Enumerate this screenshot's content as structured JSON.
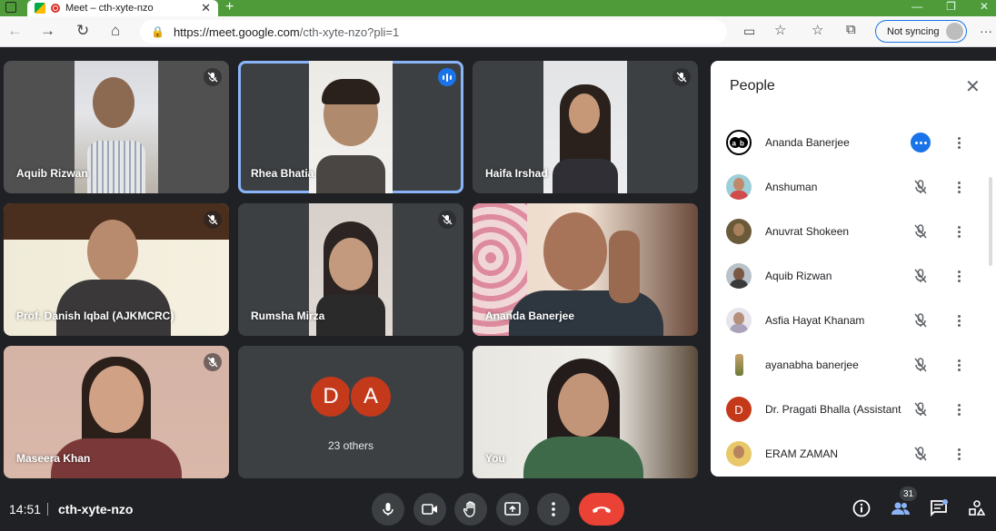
{
  "browser": {
    "tab_title": "Meet – cth-xyte-nzo",
    "url_host": "https://meet.google.com",
    "url_path": "/cth-xyte-nzo?pli=1",
    "sync_label": "Not syncing"
  },
  "tiles": [
    {
      "name": "Aquib Rizwan",
      "muted": true
    },
    {
      "name": "Rhea Bhatia",
      "speaking": true
    },
    {
      "name": "Haifa Irshad",
      "muted": true
    },
    {
      "name": "Prof. Danish Iqbal (AJKMCRC)",
      "muted": true
    },
    {
      "name": "Rumsha Mirza",
      "muted": true
    },
    {
      "name": "Ananda Banerjee"
    },
    {
      "name": "Maseera Khan",
      "muted": true
    },
    {
      "others_label": "23 others",
      "initials": [
        "D",
        "A"
      ]
    },
    {
      "name": "You"
    }
  ],
  "people_panel": {
    "title": "People",
    "participants": [
      {
        "name": "Ananda Banerjee"
      },
      {
        "name": "Anshuman"
      },
      {
        "name": "Anuvrat Shokeen"
      },
      {
        "name": "Aquib Rizwan"
      },
      {
        "name": "Asfia Hayat Khanam"
      },
      {
        "name": "ayanabha banerjee"
      },
      {
        "name": "Dr. Pragati Bhalla (Assistant",
        "initial": "D"
      },
      {
        "name": "ERAM ZAMAN"
      }
    ]
  },
  "bottom_bar": {
    "time": "14:51",
    "meeting_code": "cth-xyte-nzo",
    "people_count": "31"
  },
  "colors": {
    "brand_tab": "#4f9b3a",
    "accent": "#1a73e8",
    "end_call": "#ea4335",
    "avatar_red": "#c5391b"
  }
}
